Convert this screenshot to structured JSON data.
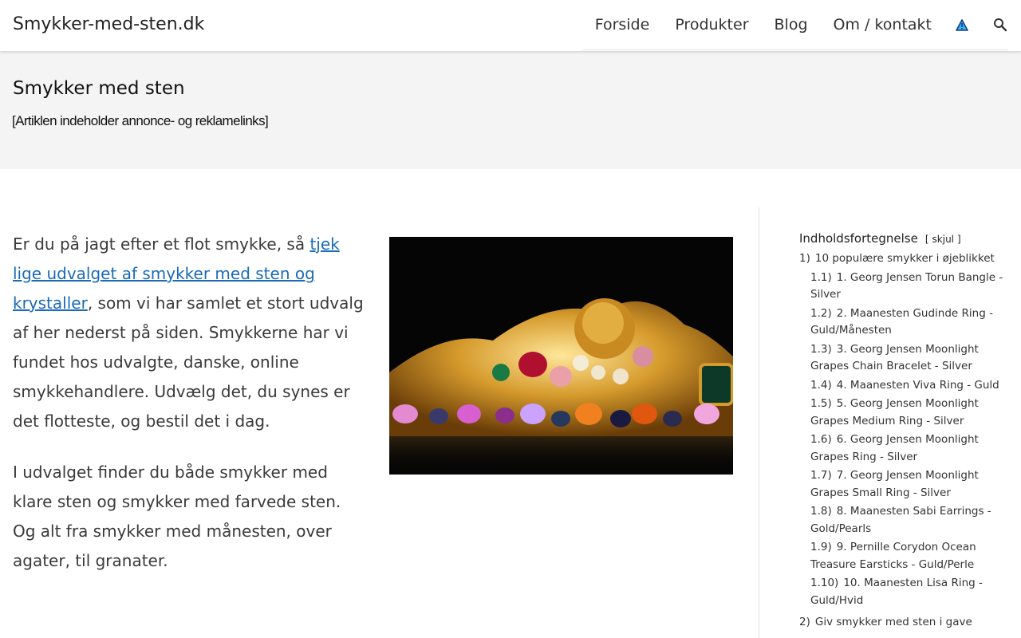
{
  "header": {
    "site_title": "Smykker-med-sten.dk",
    "nav": [
      "Forside",
      "Produkter",
      "Blog",
      "Om / kontakt"
    ],
    "icons": [
      "warning-triangle-icon",
      "search-icon"
    ]
  },
  "page": {
    "title": "Smykker med sten",
    "disclaimer": "[Artiklen indeholder annonce- og reklamelinks]"
  },
  "content": {
    "p1_before": "Er du på jagt efter et flot smykke, så ",
    "p1_link": "tjek lige udvalget af smykker med sten og krystaller",
    "p1_after": ", som vi har samlet et stort udvalg af her nederst på siden. Smykkerne har vi fundet hos udvalgte, danske, online smykkehandlere. Udvælg det, du synes er det flotteste, og bestil det i dag.",
    "p2": "I udvalget finder du både smykker med klare sten og smykker med farvede sten. Og alt fra smykker med månesten, over agater, til granater."
  },
  "toc": {
    "title": "Indholdsfortegnelse",
    "toggle_open": "[",
    "toggle_label": "skjul",
    "toggle_close": "]",
    "items": [
      {
        "num": "1)",
        "label": "10 populære smykker i øjeblikket",
        "children": [
          {
            "num": "1.1)",
            "label": "1. Georg Jensen Torun Bangle - Silver"
          },
          {
            "num": "1.2)",
            "label": "2. Maanesten Gudinde Ring - Guld/Månesten"
          },
          {
            "num": "1.3)",
            "label": "3. Georg Jensen Moonlight Grapes Chain Bracelet - Silver"
          },
          {
            "num": "1.4)",
            "label": "4. Maanesten Viva Ring - Guld"
          },
          {
            "num": "1.5)",
            "label": "5. Georg Jensen Moonlight Grapes Medium Ring - Silver"
          },
          {
            "num": "1.6)",
            "label": "6. Georg Jensen Moonlight Grapes Ring - Silver"
          },
          {
            "num": "1.7)",
            "label": "7. Georg Jensen Moonlight Grapes Small Ring - Silver"
          },
          {
            "num": "1.8)",
            "label": "8. Maanesten Sabi Earrings - Gold/Pearls"
          },
          {
            "num": "1.9)",
            "label": "9. Pernille Corydon Ocean Treasure Earsticks - Guld/Perle"
          },
          {
            "num": "1.10)",
            "label": "10. Maanesten Lisa Ring - Guld/Hvid"
          }
        ]
      },
      {
        "num": "2)",
        "label": "Giv smykker med sten i gave",
        "children": []
      }
    ]
  },
  "colors": {
    "link": "#1a6bb8",
    "band": "#f4f4f4"
  }
}
